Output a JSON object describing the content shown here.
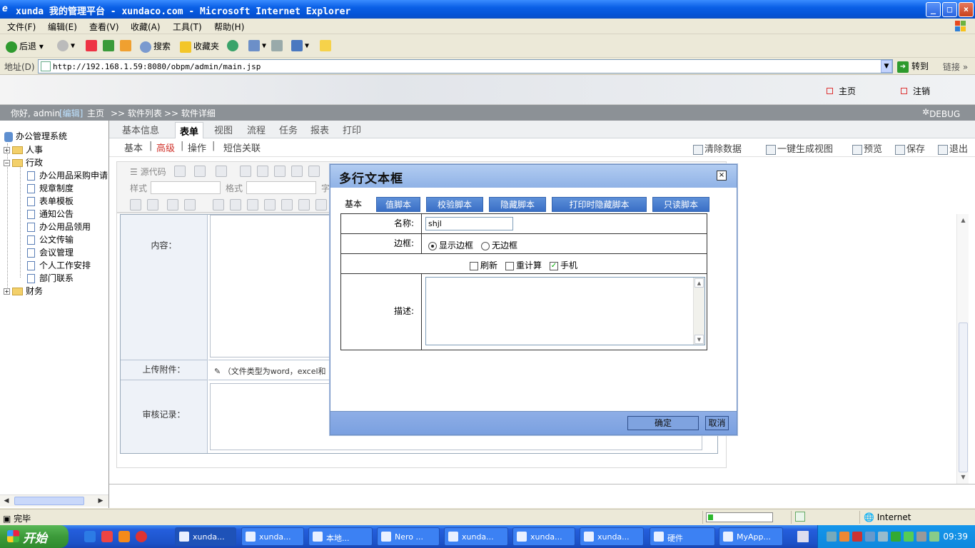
{
  "window": {
    "title": "xunda 我的管理平台 - xundaco.com - Microsoft Internet Explorer",
    "controls": [
      "_",
      "□",
      "×"
    ]
  },
  "menu": [
    "文件(F)",
    "编辑(E)",
    "查看(V)",
    "收藏(A)",
    "工具(T)",
    "帮助(H)"
  ],
  "toolbar": {
    "back": "后退",
    "search": "搜索",
    "favorites": "收藏夹"
  },
  "address": {
    "label": "地址(D)",
    "url": "http://192.168.1.59:8080/obpm/admin/main.jsp",
    "go": "转到",
    "links": "链接"
  },
  "app_header": {
    "home": "主页",
    "logout": "注销"
  },
  "crumb": {
    "greeting": "你好, admin",
    "edit": "[编辑]",
    "home": "主页",
    "level1": ">> 软件列表",
    "level2": ">> 软件详细",
    "debug": "DEBUG"
  },
  "tree": {
    "root": "办公管理系统",
    "nodes": [
      {
        "label": "人事"
      },
      {
        "label": "行政"
      },
      {
        "label": "办公用品采购申请"
      },
      {
        "label": "规章制度"
      },
      {
        "label": "表单模板"
      },
      {
        "label": "通知公告"
      },
      {
        "label": "办公用品领用"
      },
      {
        "label": "公文传输"
      },
      {
        "label": "会议管理"
      },
      {
        "label": "个人工作安排"
      },
      {
        "label": "部门联系"
      },
      {
        "label": "财务"
      }
    ]
  },
  "main_tabs": [
    "基本信息",
    "表单",
    "视图",
    "流程",
    "任务",
    "报表",
    "打印"
  ],
  "sub_tabs": [
    "基本",
    "|",
    "高级",
    "|",
    "操作",
    "|",
    "短信关联"
  ],
  "actions": [
    "清除数据",
    "一键生成视图",
    "预览",
    "保存",
    "退出"
  ],
  "editor": {
    "source": "源代码",
    "style_label": "样式",
    "format_label": "格式",
    "font_label_partial": "字"
  },
  "form": {
    "content_label": "内容：",
    "attach_label": "上传附件：",
    "attach_hint": "（文件类型为word，excel和",
    "review_label": "审核记录："
  },
  "dialog": {
    "title": "多行文本框",
    "close": "×",
    "tabs": [
      "基本",
      "值脚本",
      "校验脚本",
      "隐藏脚本",
      "打印时隐藏脚本",
      "只读脚本"
    ],
    "name_label": "名称:",
    "name_value": "shjl",
    "border_label": "边框:",
    "border_options": [
      "显示边框",
      "无边框"
    ],
    "checkboxes": [
      "刷新",
      "重计算",
      "手机"
    ],
    "desc_label": "描述:",
    "ok": "确定",
    "cancel": "取消"
  },
  "status": {
    "text": "完毕",
    "zone": "Internet",
    "progress": 0.08
  },
  "taskbar": {
    "start": "开始",
    "tasks": [
      "xunda...",
      "xunda...",
      "本地...",
      "Nero ...",
      "xunda...",
      "xunda...",
      "xunda...",
      "硬件",
      "MyApp..."
    ],
    "clock": "09:39"
  }
}
